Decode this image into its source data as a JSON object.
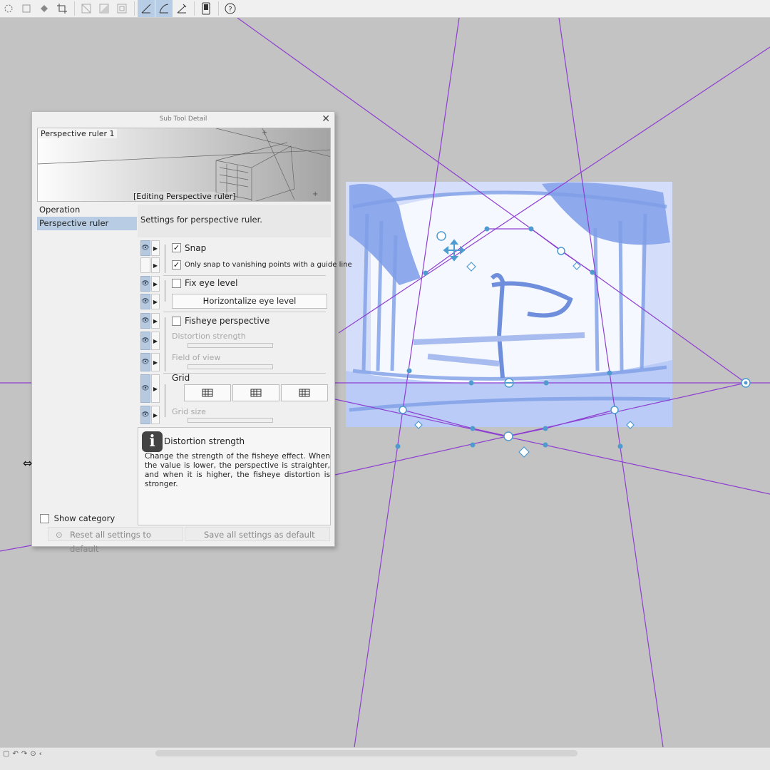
{
  "dialog": {
    "title": "Sub Tool Detail",
    "close_glyph": "✕",
    "preview_name": "Perspective ruler 1",
    "preview_status": "[Editing Perspective ruler]",
    "categories": [
      "Operation",
      "Perspective ruler"
    ],
    "selected_category": "Perspective ruler",
    "settings_header": "Settings for perspective ruler.",
    "snap": {
      "label": "Snap",
      "checked": true
    },
    "only_snap": {
      "label": "Only snap to vanishing points with a guide line",
      "checked": true
    },
    "fix_eye_level": {
      "label": "Fix eye level",
      "checked": false
    },
    "horizontalize_button": "Horizontalize eye level",
    "fisheye": {
      "label": "Fisheye perspective",
      "checked": false
    },
    "distortion_strength_label": "Distortion strength",
    "field_of_view_label": "Field of view",
    "grid_label": "Grid",
    "grid_size_label": "Grid size",
    "help": {
      "title": "Distortion strength",
      "text": "Change the strength of the fisheye effect. When the value is lower, the perspective is straighter, and when it is higher, the fisheye distortion is stronger."
    },
    "show_category": "Show category",
    "reset_button": "Reset all settings to default",
    "save_button": "Save all settings as default"
  },
  "colors": {
    "guide_line": "#8e3fd1",
    "handle": "#4f9bd0",
    "sketch": "#7e9fe6",
    "selection": "#b8cde3"
  },
  "icons": {
    "eye": "eye-icon",
    "expand": "expand-triangle-icon",
    "help": "info-icon",
    "cursor": "resize-cursor-icon"
  }
}
